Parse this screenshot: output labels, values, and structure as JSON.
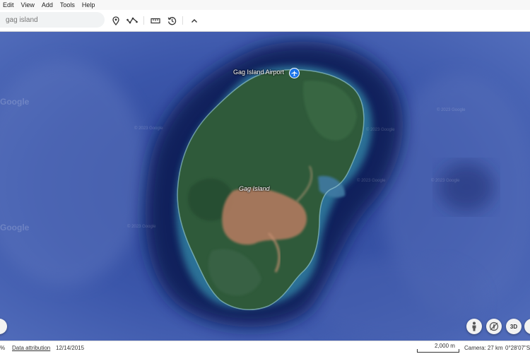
{
  "menu": {
    "items": [
      "Edit",
      "View",
      "Add",
      "Tools",
      "Help"
    ]
  },
  "search": {
    "value": "gag island"
  },
  "map": {
    "place_labels": {
      "airport": "Gag Island Airport",
      "island": "Gag Island"
    },
    "watermark_google": "Google",
    "watermark_copyright": "© 2023 Google"
  },
  "controls": {
    "three_d_label": "3D"
  },
  "status": {
    "percent": "%",
    "data_attribution": "Data attribution",
    "date": "12/14/2015",
    "scale": "2,000 m",
    "camera": "Camera: 27 km",
    "coordinates": "0°28'07\"S"
  },
  "icons": {
    "placemark": "placemark-icon",
    "path": "path-icon",
    "ruler": "ruler-icon",
    "history": "history-icon",
    "collapse": "chevron-up-icon",
    "airport": "airport-icon",
    "pegman": "pegman-icon",
    "compass": "compass-icon"
  },
  "colors": {
    "ocean": "#3a55a8",
    "deep_water": "#0f1e55",
    "land": "#2f5a3a",
    "mining": "#b07a5f",
    "accent": "#1a73e8"
  }
}
